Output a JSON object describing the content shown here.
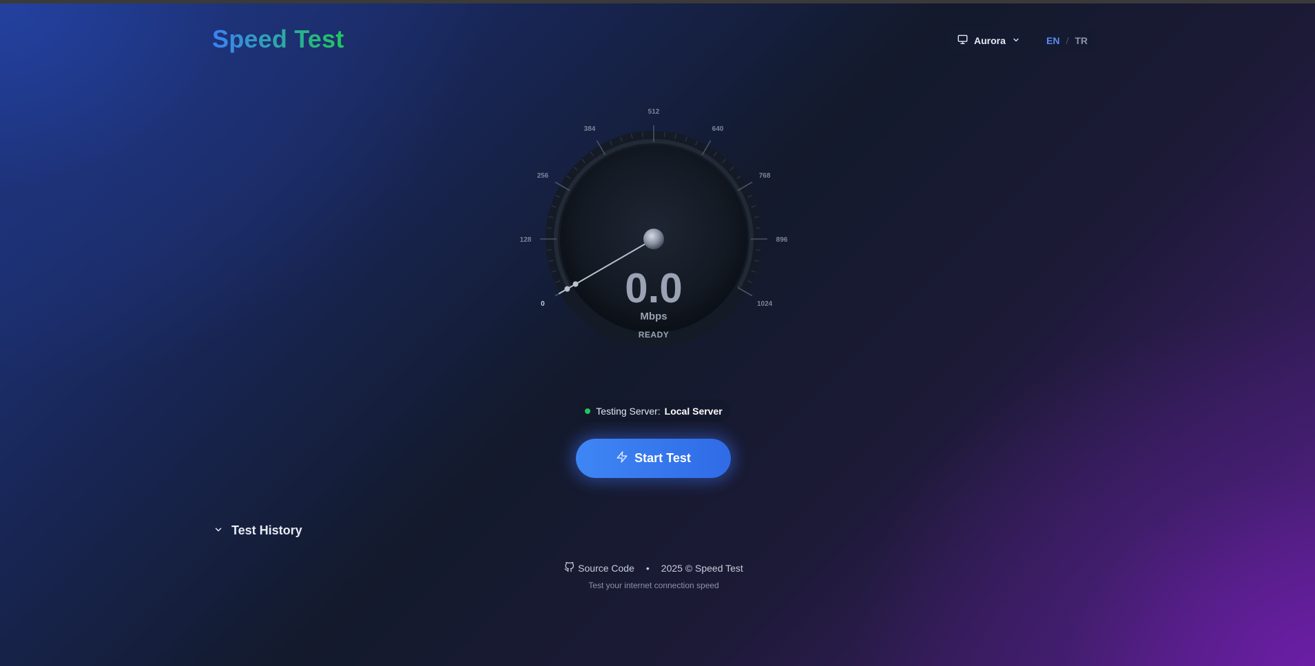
{
  "header": {
    "logo_word1": "Speed",
    "logo_word2": "Test",
    "theme": {
      "label": "Aurora",
      "icon": "monitor-icon"
    },
    "language": {
      "active": "EN",
      "separator": "/",
      "other": "TR"
    }
  },
  "gauge": {
    "value": "0.0",
    "unit": "Mbps",
    "status": "READY",
    "needle_value": 0,
    "max": 1024,
    "ticks": [
      "0",
      "128",
      "256",
      "384",
      "512",
      "640",
      "768",
      "896",
      "1024"
    ]
  },
  "server": {
    "label": "Testing Server:",
    "value": "Local Server",
    "status_color": "#22c55e"
  },
  "start_button": {
    "label": "Start Test",
    "icon": "lightning-icon"
  },
  "history": {
    "label": "Test History",
    "icon": "chevron-down-icon"
  },
  "footer": {
    "source_label": "Source Code",
    "source_icon": "github-icon",
    "bullet": "•",
    "copyright": "2025 © Speed Test",
    "tagline": "Test your internet connection speed"
  },
  "colors": {
    "accent": "#3b82f6",
    "logo_gradient_end": "#22c55e",
    "status_green": "#22c55e"
  }
}
